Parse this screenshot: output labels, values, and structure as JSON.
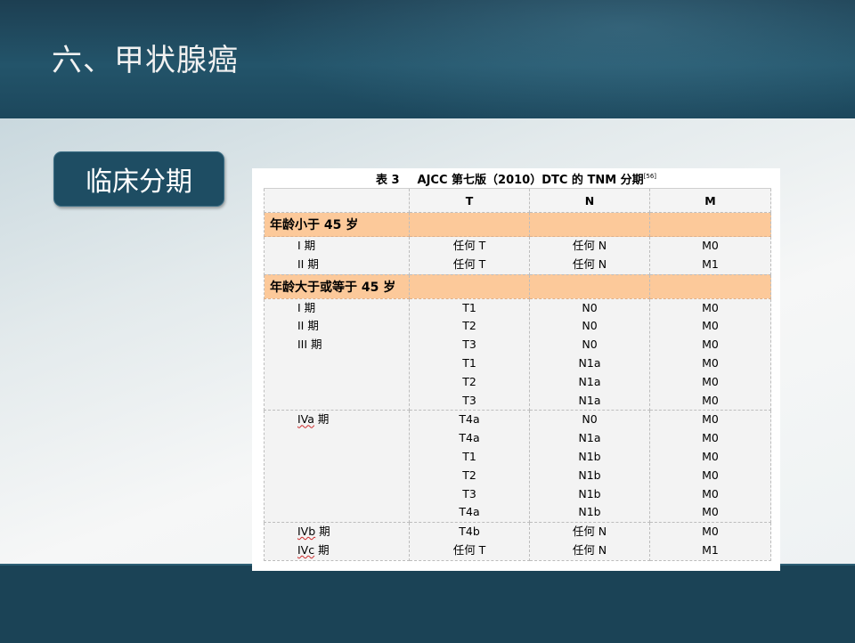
{
  "slide": {
    "title": "六、甲状腺癌",
    "section_label": "临床分期"
  },
  "colors": {
    "header_band": "#23546a",
    "footer_band": "#1b4356",
    "badge": "#1e4d63",
    "group_row": "#fcc99a",
    "cell_bg": "#f3f3f3"
  },
  "table": {
    "caption_id": "表 3",
    "caption_text": "AJCC 第七版（2010）DTC 的 TNM 分期",
    "caption_ref": "[56]",
    "headers": [
      "",
      "T",
      "N",
      "M"
    ],
    "groups": [
      {
        "label": "年龄小于 45 岁",
        "blocks": [
          {
            "stages": [
              "I 期",
              "II 期"
            ],
            "T": [
              "任何 T",
              "任何 T"
            ],
            "N": [
              "任何 N",
              "任何 N"
            ],
            "M": [
              "M0",
              "M1"
            ]
          }
        ]
      },
      {
        "label": "年龄大于或等于 45 岁",
        "blocks": [
          {
            "stages": [
              "I 期",
              "II 期",
              "III 期"
            ],
            "T": [
              "T1",
              "T2",
              "T3",
              "T1",
              "T2",
              "T3"
            ],
            "N": [
              "N0",
              "N0",
              "N0",
              "N1a",
              "N1a",
              "N1a"
            ],
            "M": [
              "M0",
              "M0",
              "M0",
              "M0",
              "M0",
              "M0"
            ]
          },
          {
            "stages": [
              "IVa 期"
            ],
            "T": [
              "T4a",
              "T4a",
              "T1",
              "T2",
              "T3",
              "T4a"
            ],
            "N": [
              "N0",
              "N1a",
              "N1b",
              "N1b",
              "N1b",
              "N1b"
            ],
            "M": [
              "M0",
              "M0",
              "M0",
              "M0",
              "M0",
              "M0"
            ]
          },
          {
            "stages": [
              "IVb 期",
              "IVc 期"
            ],
            "T": [
              "T4b",
              "任何 T"
            ],
            "N": [
              "任何 N",
              "任何 N"
            ],
            "M": [
              "M0",
              "M1"
            ]
          }
        ]
      }
    ]
  }
}
